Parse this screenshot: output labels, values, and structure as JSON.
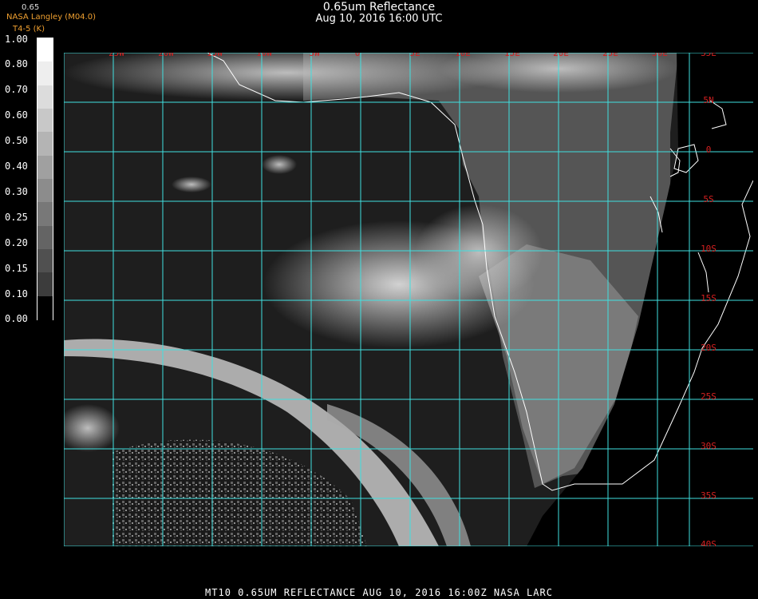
{
  "header": {
    "title": "0.65um Reflectance",
    "subtitle": "Aug 10, 2016 16:00 UTC",
    "credit": "NASA Langley (M04.0)",
    "credit_sub": "T4-5 (K)",
    "band": "0.65"
  },
  "colorbar": {
    "ticks": [
      "1.00",
      "0.80",
      "0.70",
      "0.60",
      "0.50",
      "0.40",
      "0.30",
      "0.25",
      "0.20",
      "0.15",
      "0.10",
      "0.00"
    ],
    "colors": [
      "#ffffff",
      "#eeeeee",
      "#dcdcdc",
      "#c8c8c8",
      "#b4b4b4",
      "#a0a0a0",
      "#8c8c8c",
      "#787878",
      "#646464",
      "#505050",
      "#3c3c3c",
      "#000000"
    ]
  },
  "map": {
    "lon_labels": [
      "25W",
      "20W",
      "15W",
      "10W",
      "5W",
      "0",
      "5E",
      "10E",
      "15E",
      "20E",
      "25E",
      "30E"
    ],
    "lat_labels": [
      "35E",
      "5N",
      "0",
      "5S",
      "10S",
      "15S",
      "20S",
      "25S",
      "30S",
      "35S",
      "40S"
    ],
    "grid_color": "#40e0e0",
    "label_color": "#d42020"
  },
  "footer": {
    "text": "MT10  0.65UM REFLECTANCE   AUG 10, 2016 16:00Z   NASA LARC"
  }
}
